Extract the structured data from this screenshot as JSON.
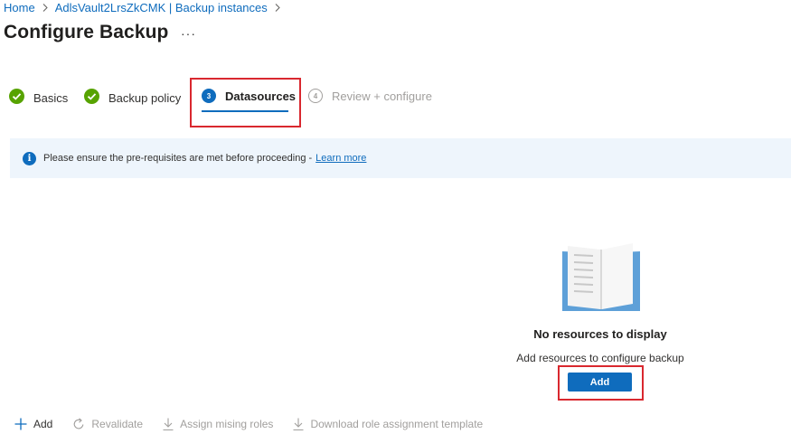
{
  "breadcrumb": [
    {
      "label": "Home"
    },
    {
      "label": "AdlsVault2LrsZkCMK | Backup instances"
    }
  ],
  "page_title": "Configure Backup",
  "more_label": "···",
  "steps": [
    {
      "label": "Basics",
      "state": "done"
    },
    {
      "label": "Backup policy",
      "state": "done"
    },
    {
      "label": "Datasources",
      "number": "3",
      "state": "active"
    },
    {
      "label": "Review + configure",
      "number": "4",
      "state": "pending"
    }
  ],
  "info": {
    "message": "Please ensure the pre-requisites are met before proceeding -",
    "link": "Learn more"
  },
  "empty_state": {
    "title": "No resources to display",
    "subtitle": "Add resources to configure backup",
    "add_label": "Add"
  },
  "toolbar": [
    {
      "label": "Add",
      "icon": "plus-icon",
      "enabled": true
    },
    {
      "label": "Revalidate",
      "icon": "refresh-icon",
      "enabled": false
    },
    {
      "label": "Assign mising roles",
      "icon": "download-icon",
      "enabled": false
    },
    {
      "label": "Download role assignment template",
      "icon": "download-icon",
      "enabled": false
    }
  ],
  "colors": {
    "accent": "#0f6cbd",
    "success": "#57a300",
    "highlight": "#d9282f",
    "info_background": "#eef5fc"
  }
}
